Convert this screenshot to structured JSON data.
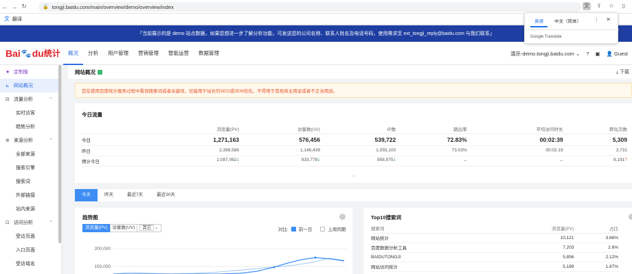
{
  "browser": {
    "url": "tongji.baidu.com/main/overview/demo/overview/index",
    "translate_label": "翻译"
  },
  "translate_popup": {
    "lang_en": "英语",
    "lang_zh": "中文（简体）",
    "brand": "Google Translate"
  },
  "notice": "「当前展示的是 demo 站点数据，如果您想进一步了解分析功能，可发送您的公司名称、联系人姓名及电话号码，使用需求至 ext_tongji_reply@baidu.com 与我们联系」",
  "topnav": {
    "logo_bai": "Bai",
    "logo_du": "du",
    "logo_tongji": "统计",
    "menu": [
      "概况",
      "分析",
      "用户管理",
      "营销管理",
      "智能运营",
      "数据管理"
    ],
    "site": "演示-demo.tongji.baidu.com",
    "guest": "Guest"
  },
  "sidebar": {
    "custom": "定制版",
    "overview": "网站概况",
    "traffic_group": "流量分析",
    "traffic_items": [
      "实时访客",
      "趋势分析"
    ],
    "source_group": "来源分析",
    "source_items": [
      "全部来源",
      "搜索引擎",
      "搜索词",
      "外部链接",
      "站内来源"
    ],
    "visit_group": "访问分析",
    "visit_items": [
      "受访页面",
      "入口页面",
      "受访域名"
    ]
  },
  "page": {
    "title": "网站概况",
    "download": "下载",
    "warning": "您在使用百度统计服务过程中看到搜索词或者关键词，仅能用于站长的SEO或SEM优化，不得用于其他商业用途或者不正当用途。"
  },
  "traffic": {
    "title": "今日流量",
    "headers": [
      "",
      "浏览量(PV)",
      "访客数(UV)",
      "IP数",
      "跳出率",
      "平均访问时长",
      "转化次数"
    ],
    "rows": [
      {
        "label": "今日",
        "pv": "1,271,163",
        "uv": "576,456",
        "ip": "539,722",
        "bounce": "72.83%",
        "dur": "00:02:39",
        "conv": "5,309"
      },
      {
        "label": "昨日",
        "pv": "2,398,588",
        "uv": "1,146,439",
        "ip": "1,055,100",
        "bounce": "73.03%",
        "dur": "00:02:19",
        "conv": "3,731"
      },
      {
        "label": "预计今日",
        "pv": "2,087,082",
        "uv": "933,778",
        "ip": "858,975",
        "bounce": "--",
        "dur": "--",
        "conv": "8,191"
      }
    ]
  },
  "date_tabs": [
    "今天",
    "昨天",
    "最近7天",
    "最近30天"
  ],
  "trend": {
    "title": "趋势图",
    "metrics": [
      "浏览量(PV)",
      "访客数(UV)",
      "其它"
    ],
    "compare_label": "对比:",
    "cmp_prev_day": "前一日",
    "cmp_prev_week": "上周同期",
    "y_ticks": [
      "200,000",
      "150,000"
    ]
  },
  "top10": {
    "title": "Top10搜索词",
    "headers": [
      "搜索词",
      "浏览量(PV)",
      "占比"
    ],
    "rows": [
      {
        "kw": "网站统计",
        "pv": "10,121",
        "pct": "3.66%"
      },
      {
        "kw": "百度数据分析工具",
        "pv": "7,203",
        "pct": "2.6%"
      },
      {
        "kw": "BAIDUTONGJI",
        "pv": "5,856",
        "pct": "2.12%"
      },
      {
        "kw": "网站访问统计",
        "pv": "5,189",
        "pct": "1.87%"
      }
    ]
  },
  "colors": {
    "notice_bg": "#1e3ea1",
    "accent": "#3d8df5",
    "warning_text": "#e4542a",
    "down": "#2fa043",
    "up": "#e5452f"
  }
}
